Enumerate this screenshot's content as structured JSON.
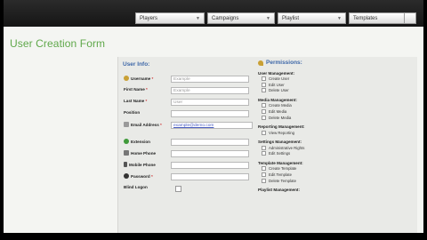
{
  "nav": {
    "tabs": [
      {
        "label": "Players"
      },
      {
        "label": "Campaigns"
      },
      {
        "label": "Playlist"
      },
      {
        "label": "Templates"
      }
    ]
  },
  "page": {
    "title": "User Creation Form"
  },
  "user_info": {
    "heading": "User Info:",
    "fields": [
      {
        "label": "Username",
        "required": "*",
        "value": "Example"
      },
      {
        "label": "First Name",
        "required": "*",
        "value": "Example"
      },
      {
        "label": "Last Name",
        "required": "*",
        "value": "User"
      },
      {
        "label": "Position",
        "required": "",
        "value": ""
      },
      {
        "label": "Email Address",
        "required": "*",
        "value": "example@demo.com"
      },
      {
        "label": "Extension",
        "required": "",
        "value": ""
      },
      {
        "label": "Home Phone",
        "required": "",
        "value": ""
      },
      {
        "label": "Mobile Phone",
        "required": "",
        "value": ""
      },
      {
        "label": "Password",
        "required": "*",
        "value": ""
      },
      {
        "label": "Blind Logon",
        "required": "",
        "value": ""
      }
    ]
  },
  "permissions": {
    "heading": "Permissions:",
    "groups": [
      {
        "title": "User Management:",
        "items": [
          "Create User",
          "Edit User",
          "Delete User"
        ]
      },
      {
        "title": "Media Management:",
        "items": [
          "Create Media",
          "Edit Media",
          "Delete Media"
        ]
      },
      {
        "title": "Reporting Management:",
        "items": [
          "View Reporting"
        ]
      },
      {
        "title": "Settings Management:",
        "items": [
          "Administrative Rights",
          "Edit Settings"
        ]
      },
      {
        "title": "Template Management:",
        "items": [
          "Create Template",
          "Edit Template",
          "Delete Template"
        ]
      },
      {
        "title": "Playlist Management:",
        "items": []
      }
    ]
  },
  "colors": {
    "title_green": "#5fa84a",
    "heading_blue": "#3d67a8"
  }
}
